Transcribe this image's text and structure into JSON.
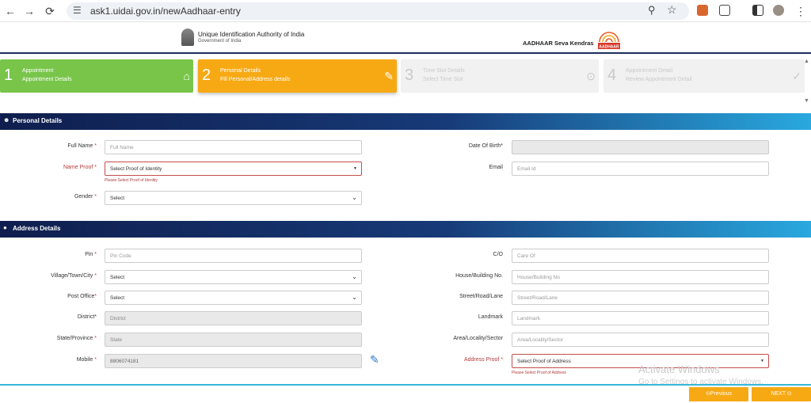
{
  "browser": {
    "url": "ask1.uidai.gov.in/newAadhaar-entry",
    "back_icon": "←",
    "forward_icon": "→",
    "reload_icon": "⟳",
    "site_icon": "☰",
    "zoom_icon": "⚲",
    "star_icon": "☆",
    "menu_icon": "⋮"
  },
  "header": {
    "org_line1": "Unique Identification Authority of India",
    "org_line2": "Government of India",
    "seva": "AADHAAR Seva Kendras",
    "logo_text": "AADHAAR"
  },
  "steps": [
    {
      "num": "1",
      "title": "Appointment",
      "subtitle": "Appointment Details",
      "icon": "⌂"
    },
    {
      "num": "2",
      "title": "Personal Details",
      "subtitle": "Fill Personal/Address details",
      "icon": "✎"
    },
    {
      "num": "3",
      "title": "Time Slot Details",
      "subtitle": "Select Time Slot",
      "icon": "⊙"
    },
    {
      "num": "4",
      "title": "Appointment Detail",
      "subtitle": "Review Appointment Detail",
      "icon": "✓"
    }
  ],
  "personal": {
    "title": "Personal Details",
    "full_name": {
      "label": "Full Name",
      "placeholder": "Full Name"
    },
    "name_proof": {
      "label": "Name Proof",
      "value": "Select Proof of Identity",
      "error": "Please Select Proof of Identity"
    },
    "gender": {
      "label": "Gender",
      "value": "Select"
    },
    "dob": {
      "label": "Date Of Birth*"
    },
    "email": {
      "label": "Email",
      "placeholder": "Email Id"
    }
  },
  "address": {
    "title": "Address Details",
    "pin": {
      "label": "Pin",
      "placeholder": "Pin Code"
    },
    "village": {
      "label": "Village/Town/City",
      "value": "Select"
    },
    "post_office": {
      "label": "Post Office",
      "value": "Select"
    },
    "district": {
      "label": "District*",
      "placeholder": "District"
    },
    "state": {
      "label": "State/Province",
      "placeholder": "State"
    },
    "mobile": {
      "label": "Mobile",
      "value": "8806074181"
    },
    "co": {
      "label": "C/O",
      "placeholder": "Care Of"
    },
    "house": {
      "label": "House/Building No.",
      "placeholder": "House/Building No"
    },
    "street": {
      "label": "Street/Road/Lane",
      "placeholder": "Street/Road/Lane"
    },
    "landmark": {
      "label": "Landmark",
      "placeholder": "Landmark"
    },
    "area": {
      "label": "Area/Locality/Sector",
      "placeholder": "Area/Locality/Sector"
    },
    "address_proof": {
      "label": "Address Proof",
      "value": "Select Proof of Address",
      "error": "Please Select Proof of Address"
    }
  },
  "buttons": {
    "previous": "⊙Previous",
    "next": "NEXT ⊙"
  },
  "watermark": {
    "line1": "Activate Windows",
    "line2": "Go to Settings to activate Windows."
  },
  "colors": {
    "green": "#78c54a",
    "orange": "#f7a914",
    "navy": "#0f1e4e",
    "cyan": "#29a9df"
  }
}
